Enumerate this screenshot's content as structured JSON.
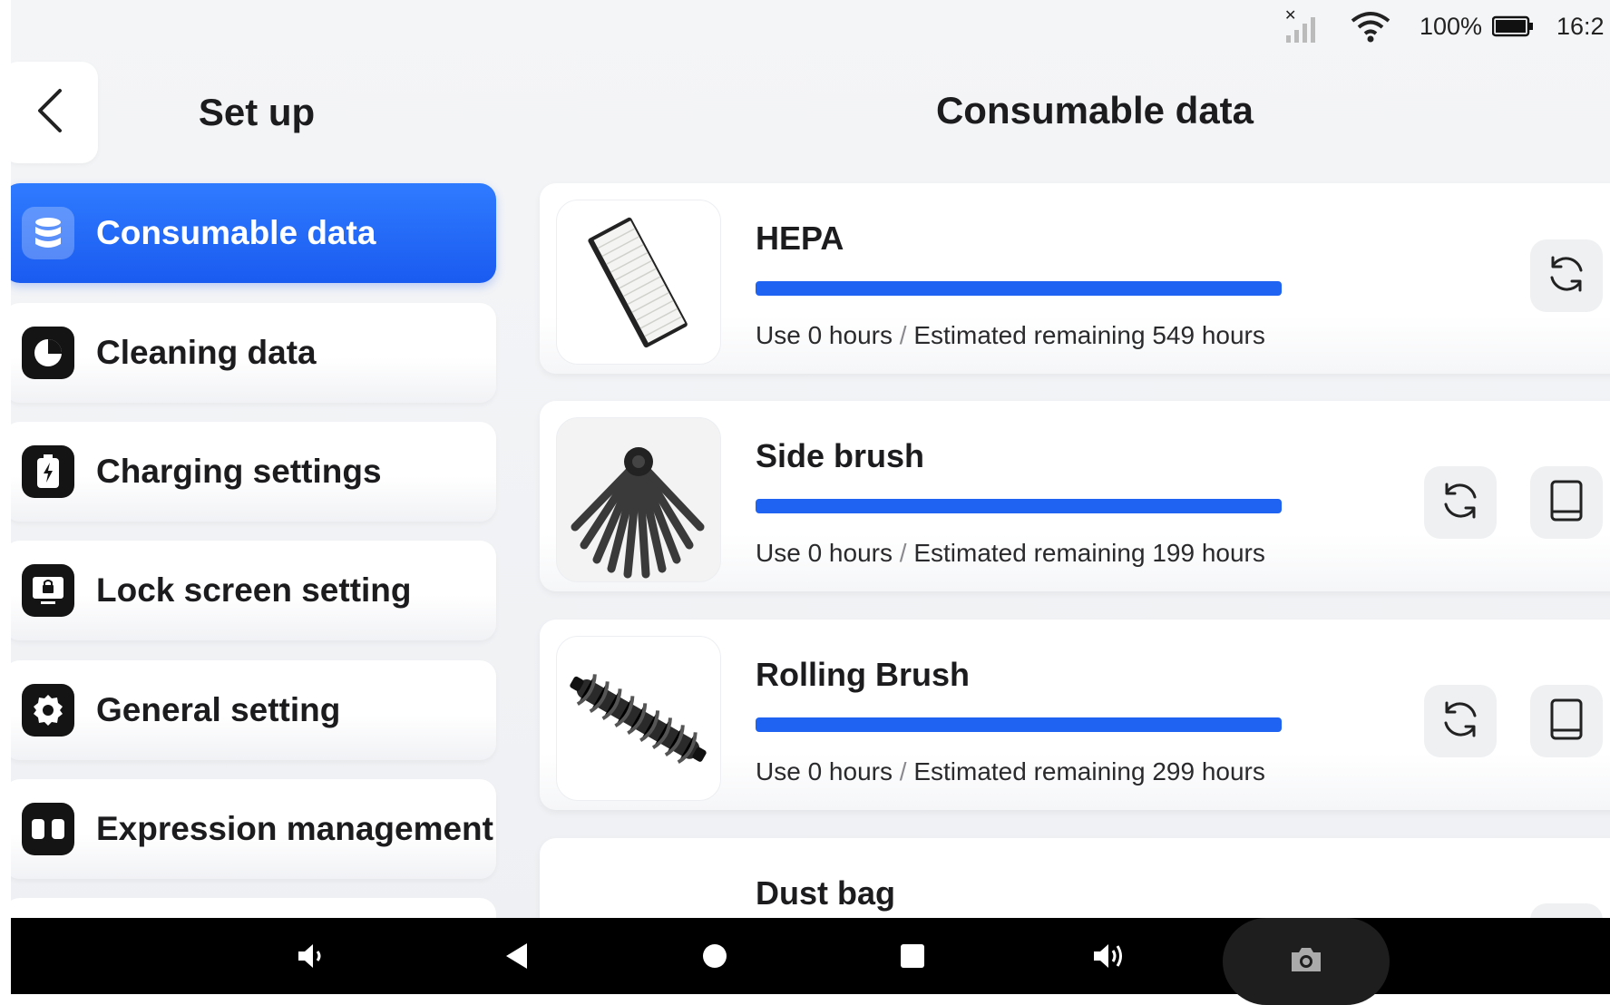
{
  "status_bar": {
    "battery_percent": "100%",
    "time": "16:2",
    "icons": [
      "no-signal-icon",
      "wifi-icon",
      "battery-icon"
    ]
  },
  "header": {
    "sidebar_title": "Set up",
    "page_title": "Consumable data"
  },
  "sidebar": {
    "items": [
      {
        "label": "Consumable data",
        "icon": "database-icon",
        "active": true
      },
      {
        "label": "Cleaning data",
        "icon": "pie-chart-icon",
        "active": false
      },
      {
        "label": "Charging settings",
        "icon": "battery-charging-icon",
        "active": false
      },
      {
        "label": "Lock screen setting",
        "icon": "lock-screen-icon",
        "active": false
      },
      {
        "label": "General setting",
        "icon": "gear-icon",
        "active": false
      },
      {
        "label": "Expression management",
        "icon": "face-icon",
        "active": false
      }
    ]
  },
  "consumables": [
    {
      "name": "HEPA",
      "used": "Use 0 hours",
      "separator": "/",
      "remaining": "Estimated remaining 549 hours",
      "remaining_fraction": 1.0,
      "buttons": [
        "reset-icon"
      ]
    },
    {
      "name": "Side brush",
      "used": "Use 0 hours",
      "separator": "/",
      "remaining": "Estimated remaining 199 hours",
      "remaining_fraction": 1.0,
      "buttons": [
        "reset-icon",
        "manual-icon"
      ]
    },
    {
      "name": "Rolling Brush",
      "used": "Use 0 hours",
      "separator": "/",
      "remaining": "Estimated remaining 299 hours",
      "remaining_fraction": 1.0,
      "buttons": [
        "reset-icon",
        "manual-icon"
      ]
    },
    {
      "name": "Dust bag"
    }
  ],
  "colors": {
    "accent": "#1f63f2",
    "active_menu": "#2f7bff",
    "background": "#f1f2f5"
  },
  "nav_bar": {
    "buttons": [
      "volume-down-icon",
      "back-triangle-icon",
      "home-circle-icon",
      "recents-square-icon",
      "volume-up-icon",
      "camera-icon"
    ]
  }
}
